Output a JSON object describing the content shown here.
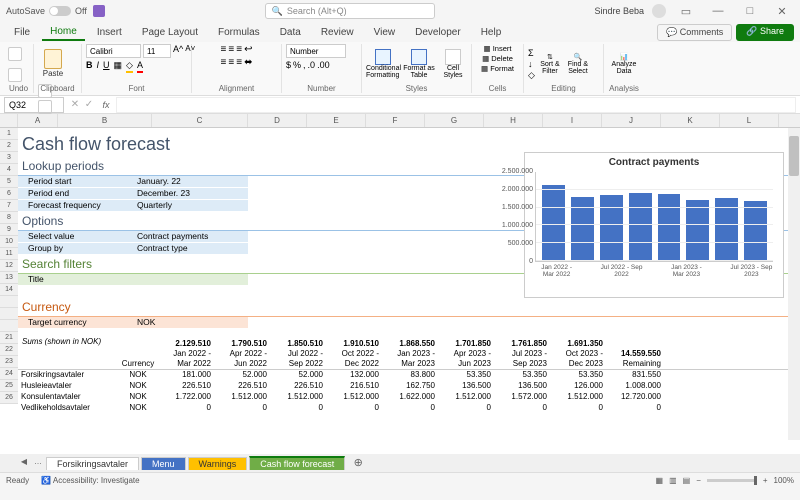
{
  "title_bar": {
    "autosave_label": "AutoSave",
    "autosave_state": "Off",
    "search_placeholder": "Search (Alt+Q)",
    "user_name": "Sindre Beba"
  },
  "menu": {
    "items": [
      "File",
      "Home",
      "Insert",
      "Page Layout",
      "Formulas",
      "Data",
      "Review",
      "View",
      "Developer",
      "Help"
    ],
    "active": "Home",
    "comments": "Comments",
    "share": "Share"
  },
  "ribbon": {
    "undo": "Undo",
    "clipboard": "Clipboard",
    "paste": "Paste",
    "font_group": "Font",
    "font_name": "Calibri",
    "font_size": "11",
    "alignment": "Alignment",
    "number_group": "Number",
    "number_format": "Number",
    "styles": "Styles",
    "cond_fmt": "Conditional Formatting",
    "fmt_table": "Format as Table",
    "cell_styles": "Cell Styles",
    "cells": "Cells",
    "insert": "Insert",
    "delete": "Delete",
    "format": "Format",
    "editing": "Editing",
    "sort_filter": "Sort & Filter",
    "find_select": "Find & Select",
    "analysis": "Analysis",
    "analyze": "Analyze Data"
  },
  "namebox": {
    "ref": "Q32"
  },
  "sheet": {
    "title": "Cash flow forecast",
    "lookup_heading": "Lookup periods",
    "lookup": [
      {
        "k": "Period start",
        "v": "January. 22"
      },
      {
        "k": "Period end",
        "v": "December. 23"
      },
      {
        "k": "Forecast frequency",
        "v": "Quarterly"
      }
    ],
    "options_heading": "Options",
    "options": [
      {
        "k": "Select value",
        "v": "Contract payments"
      },
      {
        "k": "Group by",
        "v": "Contract type"
      }
    ],
    "search_heading": "Search filters",
    "search": [
      {
        "k": "Title",
        "v": ""
      }
    ],
    "currency_heading": "Currency",
    "currency": [
      {
        "k": "Target currency",
        "v": "NOK"
      }
    ],
    "sums_label": "Sums (shown in NOK)",
    "cols": {
      "currency": "Currency",
      "remaining": "Remaining",
      "periods": [
        [
          "2.129.510",
          "Jan 2022 -",
          "Mar 2022"
        ],
        [
          "1.790.510",
          "Apr 2022 -",
          "Jun 2022"
        ],
        [
          "1.850.510",
          "Jul 2022 -",
          "Sep 2022"
        ],
        [
          "1.910.510",
          "Oct 2022 -",
          "Dec 2022"
        ],
        [
          "1.868.550",
          "Jan 2023 -",
          "Mar 2023"
        ],
        [
          "1.701.850",
          "Apr 2023 -",
          "Jun 2023"
        ],
        [
          "1.761.850",
          "Jul 2023 -",
          "Sep 2023"
        ],
        [
          "1.691.350",
          "Oct 2023 -",
          "Dec 2023"
        ]
      ],
      "remaining_total": "14.559.550"
    },
    "rows": [
      {
        "label": "Forsikringsavtaler",
        "cur": "NOK",
        "vals": [
          "181.000",
          "52.000",
          "52.000",
          "132.000",
          "83.800",
          "53.350",
          "53.350",
          "53.350"
        ],
        "rem": "831.550"
      },
      {
        "label": "Husleieavtaler",
        "cur": "NOK",
        "vals": [
          "226.510",
          "226.510",
          "226.510",
          "216.510",
          "162.750",
          "136.500",
          "136.500",
          "126.000"
        ],
        "rem": "1.008.000"
      },
      {
        "label": "Konsulentavtaler",
        "cur": "NOK",
        "vals": [
          "1.722.000",
          "1.512.000",
          "1.512.000",
          "1.512.000",
          "1.622.000",
          "1.512.000",
          "1.572.000",
          "1.512.000"
        ],
        "rem": "12.720.000"
      },
      {
        "label": "Vedlikeholdsavtaler",
        "cur": "NOK",
        "vals": [
          "0",
          "0",
          "0",
          "0",
          "0",
          "0",
          "0",
          "0"
        ],
        "rem": "0"
      }
    ]
  },
  "columns": [
    "A",
    "B",
    "C",
    "D",
    "E",
    "F",
    "G",
    "H",
    "I",
    "J",
    "K",
    "L"
  ],
  "row_nums": [
    "1",
    "2",
    "3",
    "4",
    "5",
    "6",
    "7",
    "8",
    "9",
    "10",
    "11",
    "12",
    "13",
    "14",
    "",
    "",
    "",
    "21",
    "22",
    "23",
    "24",
    "25",
    "26"
  ],
  "chart_data": {
    "type": "bar",
    "title": "Contract payments",
    "categories": [
      "Jan 2022 - Mar 2022",
      "Apr 2022 - Jun 2022",
      "Jul 2022 - Sep 2022",
      "Oct 2022 - Dec 2022",
      "Jan 2023 - Mar 2023",
      "Apr 2023 - Jun 2023",
      "Jul 2023 - Sep 2023",
      "Oct 2023 - Dec 2023"
    ],
    "values": [
      2129510,
      1790510,
      1850510,
      1910510,
      1868550,
      1701850,
      1761850,
      1691350
    ],
    "ylim": [
      0,
      2500000
    ],
    "yticks": [
      "2.500.000",
      "2.000.000",
      "1.500.000",
      "1.000.000",
      "500.000",
      "0"
    ],
    "xticks_shown": [
      "Jan 2022 - Mar 2022",
      "Jul 2022 - Sep 2022",
      "Jan 2023 - Mar 2023",
      "Jul 2023 - Sep 2023"
    ]
  },
  "tabs": {
    "prev": "…",
    "items": [
      "Forsikringsavtaler",
      "Menu",
      "Warnings",
      "Cash flow forecast"
    ],
    "active_index": 3
  },
  "status": {
    "ready": "Ready",
    "accessibility": "Accessibility: Investigate",
    "zoom": "100%"
  }
}
